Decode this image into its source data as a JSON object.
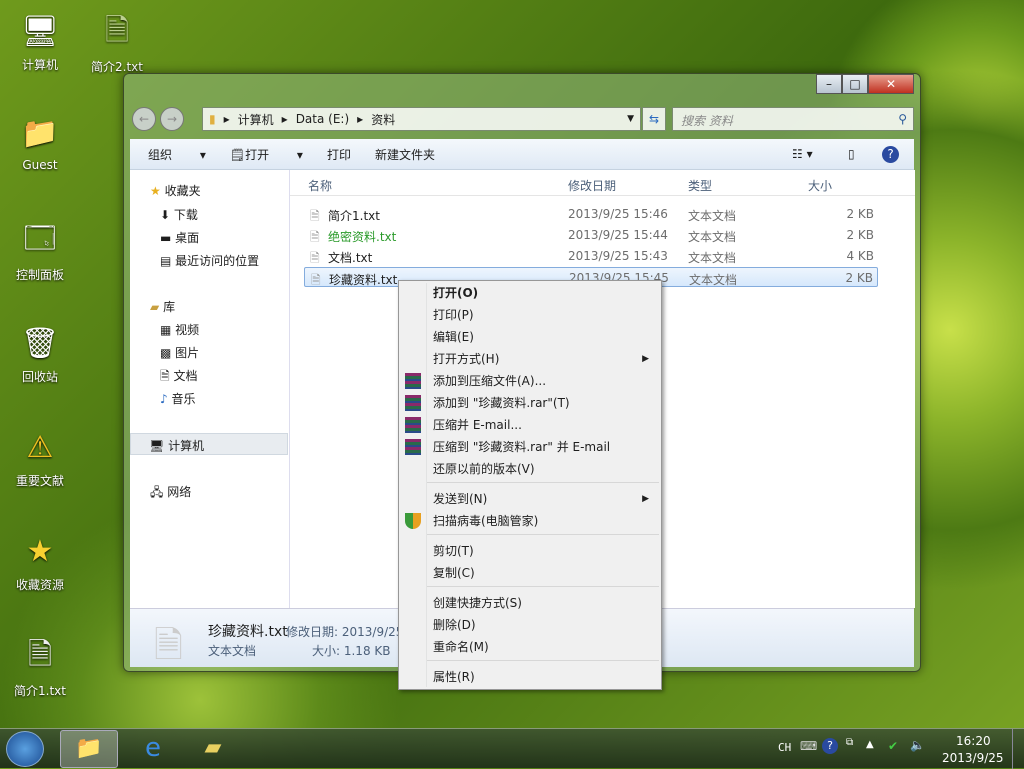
{
  "desktop": {
    "icons": [
      {
        "label": "计算机",
        "icon": "computer-icon"
      },
      {
        "label": "Guest",
        "icon": "user-folder-icon"
      },
      {
        "label": "控制面板",
        "icon": "control-panel-icon"
      },
      {
        "label": "回收站",
        "icon": "recycle-bin-icon"
      },
      {
        "label": "重要文献",
        "icon": "warning-icon"
      },
      {
        "label": "收藏资源",
        "icon": "star-shortcut-icon"
      },
      {
        "label": "简介1.txt",
        "icon": "text-file-icon"
      },
      {
        "label": "简介2.txt",
        "icon": "text-file-icon"
      }
    ]
  },
  "window": {
    "address": {
      "crumbs": [
        "计算机",
        "Data (E:)",
        "资料"
      ]
    },
    "search": {
      "placeholder": "搜索 资料"
    },
    "toolbar": {
      "organize": "组织",
      "open": "打开",
      "print": "打印",
      "new_folder": "新建文件夹"
    },
    "nav": {
      "favorites": "收藏夹",
      "downloads": "下载",
      "desktop": "桌面",
      "recent": "最近访问的位置",
      "libraries": "库",
      "videos": "视频",
      "pictures": "图片",
      "documents": "文档",
      "music": "音乐",
      "computer": "计算机",
      "network": "网络"
    },
    "columns": [
      "名称",
      "修改日期",
      "类型",
      "大小"
    ],
    "files": [
      {
        "name": "简介1.txt",
        "date": "2013/9/25 15:46",
        "type": "文本文档",
        "size": "2 KB",
        "color": "#1e1e1e"
      },
      {
        "name": "绝密资料.txt",
        "date": "2013/9/25 15:44",
        "type": "文本文档",
        "size": "2 KB",
        "color": "#2a9a2a"
      },
      {
        "name": "文档.txt",
        "date": "2013/9/25 15:43",
        "type": "文本文档",
        "size": "4 KB",
        "color": "#1e1e1e"
      },
      {
        "name": "珍藏资料.txt",
        "date": "2013/9/25 15:45",
        "type": "文本文档",
        "size": "2 KB",
        "color": "#1e1e1e",
        "selected": true
      }
    ],
    "details": {
      "name": "珍藏资料.txt",
      "type": "文本文档",
      "date_label": "修改日期: 2013/9/25",
      "size_label": "大小: 1.18 KB"
    }
  },
  "context_menu": {
    "items": [
      "打开(O)",
      "打印(P)",
      "编辑(E)",
      "打开方式(H)",
      "添加到压缩文件(A)...",
      "添加到 \"珍藏资料.rar\"(T)",
      "压缩并 E-mail...",
      "压缩到 \"珍藏资料.rar\" 并 E-mail",
      "还原以前的版本(V)",
      "发送到(N)",
      "扫描病毒(电脑管家)",
      "剪切(T)",
      "复制(C)",
      "创建快捷方式(S)",
      "删除(D)",
      "重命名(M)",
      "属性(R)"
    ]
  },
  "taskbar": {
    "lang": "CH",
    "time": "16:20",
    "date": "2013/9/25"
  }
}
